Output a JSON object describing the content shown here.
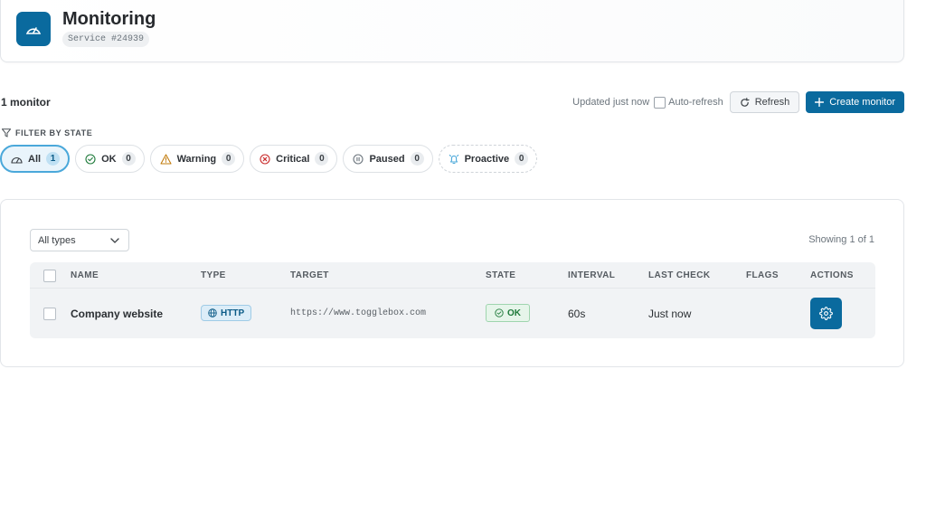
{
  "header": {
    "title": "Monitoring",
    "service_id": "Service #24939",
    "icon": "gauge-icon"
  },
  "toolbar": {
    "count_text": "1 monitor",
    "updated_text": "Updated just now",
    "auto_refresh_label": "Auto-refresh",
    "auto_refresh_checked": false,
    "refresh_label": "Refresh",
    "create_label": "Create monitor"
  },
  "filter": {
    "heading": "FILTER BY STATE",
    "chips": [
      {
        "label": "All",
        "count": "1",
        "icon": "gauge-icon",
        "active": true
      },
      {
        "label": "OK",
        "count": "0",
        "icon": "check-circle-icon"
      },
      {
        "label": "Warning",
        "count": "0",
        "icon": "warning-triangle-icon"
      },
      {
        "label": "Critical",
        "count": "0",
        "icon": "x-circle-icon"
      },
      {
        "label": "Paused",
        "count": "0",
        "icon": "pause-circle-icon"
      },
      {
        "label": "Proactive",
        "count": "0",
        "icon": "bell-icon"
      }
    ]
  },
  "table": {
    "type_filter": "All types",
    "showing": "Showing 1 of 1",
    "columns": [
      "NAME",
      "TYPE",
      "TARGET",
      "STATE",
      "INTERVAL",
      "LAST CHECK",
      "FLAGS",
      "ACTIONS"
    ],
    "rows": [
      {
        "name": "Company website",
        "type": "HTTP",
        "target": "https://www.togglebox.com",
        "state": "OK",
        "interval": "60s",
        "last_check": "Just now",
        "flags": ""
      }
    ]
  },
  "colors": {
    "primary": "#0a6a9e",
    "ok": "#1e7a3a",
    "warning": "#c27c0e",
    "critical": "#c92a2a",
    "proactive": "#4aa8da"
  }
}
